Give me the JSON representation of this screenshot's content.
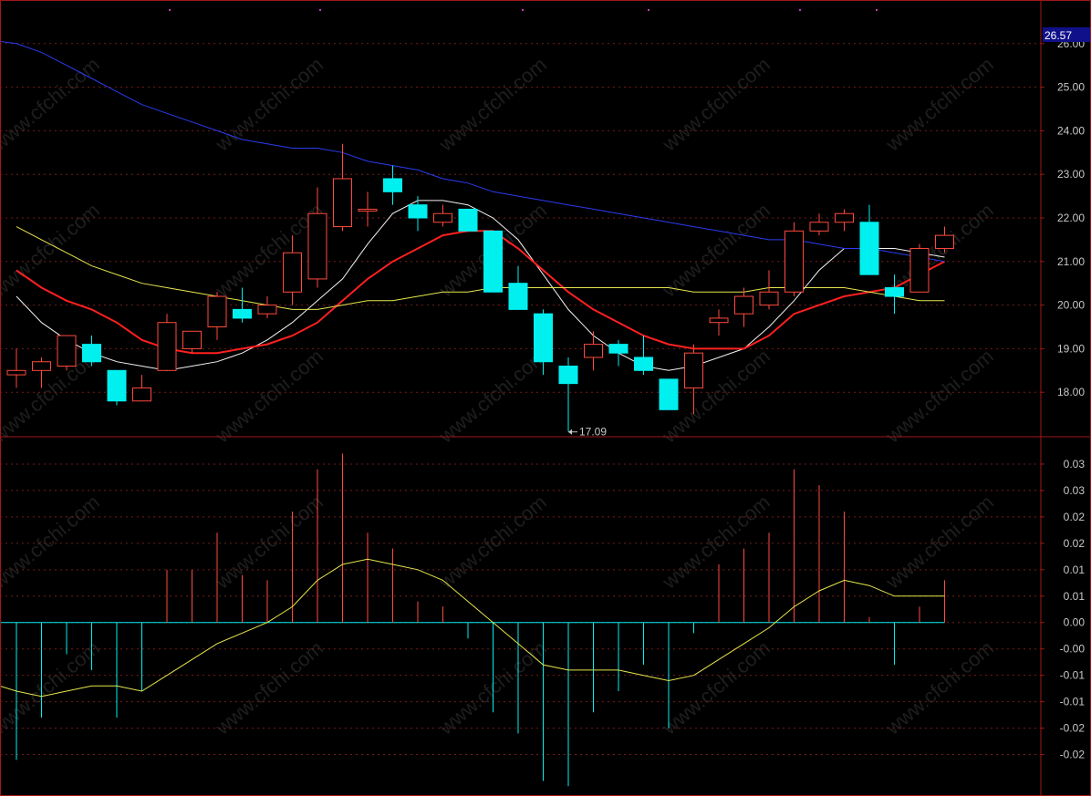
{
  "colors": {
    "background": "#000000",
    "frame": "#a01818",
    "grid": "#7a1a1a",
    "up": "#ff4a3d",
    "down": "#00f0f0",
    "ma_white": "#f2f2f2",
    "ma_red": "#ff2020",
    "ma_yellow": "#e6e64d",
    "ma_blue": "#2a3cf0",
    "axis_text": "#c8c8c8",
    "price_tag_bg": "#10108a",
    "watermark": "#1e1e1e"
  },
  "watermark_text": "www.cfchi.com",
  "chart_data": [
    {
      "type": "candlestick",
      "price_axis": {
        "ylim": [
          17.0,
          27.0
        ],
        "ticks": [
          "26.00",
          "25.00",
          "24.00",
          "23.00",
          "22.00",
          "21.00",
          "20.00",
          "19.00",
          "18.00"
        ],
        "last_price": "26.57"
      },
      "annotation": {
        "label": "17.09",
        "value": 17.09,
        "bar_index": 22
      },
      "candles": [
        {
          "o": 18.4,
          "h": 19.0,
          "l": 18.1,
          "c": 18.5
        },
        {
          "o": 18.5,
          "h": 18.8,
          "l": 18.1,
          "c": 18.7
        },
        {
          "o": 18.6,
          "h": 19.3,
          "l": 18.5,
          "c": 19.3
        },
        {
          "o": 19.1,
          "h": 19.3,
          "l": 18.6,
          "c": 18.7
        },
        {
          "o": 18.5,
          "h": 18.5,
          "l": 17.7,
          "c": 17.8
        },
        {
          "o": 17.8,
          "h": 18.4,
          "l": 17.8,
          "c": 18.1
        },
        {
          "o": 18.5,
          "h": 19.8,
          "l": 18.5,
          "c": 19.6
        },
        {
          "o": 19.0,
          "h": 19.4,
          "l": 18.9,
          "c": 19.4
        },
        {
          "o": 19.5,
          "h": 20.3,
          "l": 19.2,
          "c": 20.2
        },
        {
          "o": 19.9,
          "h": 20.4,
          "l": 19.6,
          "c": 19.7
        },
        {
          "o": 19.8,
          "h": 20.2,
          "l": 19.7,
          "c": 20.0
        },
        {
          "o": 20.3,
          "h": 21.6,
          "l": 20.0,
          "c": 21.2
        },
        {
          "o": 20.6,
          "h": 22.7,
          "l": 20.4,
          "c": 22.1
        },
        {
          "o": 21.8,
          "h": 23.7,
          "l": 21.7,
          "c": 22.9
        },
        {
          "o": 22.2,
          "h": 22.6,
          "l": 21.8,
          "c": 22.2
        },
        {
          "o": 22.9,
          "h": 23.2,
          "l": 22.3,
          "c": 22.6
        },
        {
          "o": 22.3,
          "h": 22.5,
          "l": 21.7,
          "c": 22.0
        },
        {
          "o": 21.9,
          "h": 22.3,
          "l": 21.8,
          "c": 22.1
        },
        {
          "o": 22.2,
          "h": 22.2,
          "l": 21.7,
          "c": 21.7
        },
        {
          "o": 21.7,
          "h": 21.7,
          "l": 20.3,
          "c": 20.3
        },
        {
          "o": 20.5,
          "h": 20.9,
          "l": 19.9,
          "c": 19.9
        },
        {
          "o": 19.8,
          "h": 19.9,
          "l": 18.4,
          "c": 18.7
        },
        {
          "o": 18.6,
          "h": 18.8,
          "l": 17.1,
          "c": 18.2
        },
        {
          "o": 18.8,
          "h": 19.4,
          "l": 18.5,
          "c": 19.1
        },
        {
          "o": 19.1,
          "h": 19.2,
          "l": 18.6,
          "c": 18.9
        },
        {
          "o": 18.8,
          "h": 19.3,
          "l": 18.4,
          "c": 18.5
        },
        {
          "o": 18.3,
          "h": 18.3,
          "l": 17.6,
          "c": 17.6
        },
        {
          "o": 18.1,
          "h": 19.1,
          "l": 17.5,
          "c": 18.9
        },
        {
          "o": 19.6,
          "h": 19.9,
          "l": 19.3,
          "c": 19.7
        },
        {
          "o": 19.8,
          "h": 20.4,
          "l": 19.5,
          "c": 20.2
        },
        {
          "o": 20.0,
          "h": 20.8,
          "l": 19.9,
          "c": 20.3
        },
        {
          "o": 20.3,
          "h": 21.9,
          "l": 20.2,
          "c": 21.7
        },
        {
          "o": 21.7,
          "h": 22.1,
          "l": 21.6,
          "c": 21.9
        },
        {
          "o": 21.9,
          "h": 22.2,
          "l": 21.7,
          "c": 22.1
        },
        {
          "o": 21.9,
          "h": 22.3,
          "l": 20.7,
          "c": 20.7
        },
        {
          "o": 20.4,
          "h": 20.7,
          "l": 19.8,
          "c": 20.2
        },
        {
          "o": 20.3,
          "h": 21.4,
          "l": 20.3,
          "c": 21.3
        },
        {
          "o": 21.3,
          "h": 21.8,
          "l": 21.2,
          "c": 21.6
        }
      ],
      "moving_averages": [
        {
          "color_key": "ma_white",
          "width": 1,
          "values": [
            20.2,
            19.6,
            19.2,
            18.9,
            18.7,
            18.6,
            18.5,
            18.6,
            18.7,
            18.9,
            19.2,
            19.6,
            20.1,
            20.6,
            21.4,
            22.1,
            22.4,
            22.4,
            22.3,
            22.0,
            21.5,
            20.7,
            19.9,
            19.3,
            18.9,
            18.6,
            18.5,
            18.6,
            18.8,
            19.0,
            19.5,
            20.1,
            20.8,
            21.3,
            21.3,
            21.3,
            21.2,
            21.1
          ]
        },
        {
          "color_key": "ma_red",
          "width": 2,
          "values": [
            20.8,
            20.4,
            20.1,
            19.9,
            19.6,
            19.2,
            19.0,
            18.9,
            18.9,
            19.0,
            19.1,
            19.3,
            19.6,
            20.1,
            20.6,
            21.0,
            21.3,
            21.6,
            21.7,
            21.7,
            21.3,
            20.8,
            20.3,
            19.9,
            19.6,
            19.3,
            19.1,
            19.0,
            19.0,
            19.0,
            19.3,
            19.8,
            20.0,
            20.2,
            20.3,
            20.4,
            20.7,
            21.0
          ]
        },
        {
          "color_key": "ma_yellow",
          "width": 1,
          "values": [
            21.8,
            21.5,
            21.2,
            20.9,
            20.7,
            20.5,
            20.4,
            20.3,
            20.2,
            20.1,
            20.0,
            19.9,
            19.9,
            20.0,
            20.1,
            20.1,
            20.2,
            20.3,
            20.3,
            20.4,
            20.4,
            20.4,
            20.4,
            20.4,
            20.4,
            20.4,
            20.4,
            20.3,
            20.3,
            20.3,
            20.4,
            20.4,
            20.4,
            20.4,
            20.3,
            20.2,
            20.1,
            20.1
          ]
        },
        {
          "color_key": "ma_blue",
          "width": 1,
          "values": [
            26.0,
            25.8,
            25.5,
            25.2,
            24.9,
            24.6,
            24.4,
            24.2,
            24.0,
            23.8,
            23.7,
            23.6,
            23.6,
            23.5,
            23.3,
            23.2,
            23.1,
            22.9,
            22.8,
            22.6,
            22.5,
            22.4,
            22.3,
            22.2,
            22.1,
            22.0,
            21.9,
            21.8,
            21.7,
            21.6,
            21.5,
            21.5,
            21.4,
            21.3,
            21.3,
            21.2,
            21.1,
            21.0
          ]
        }
      ]
    },
    {
      "type": "bar",
      "indicator_axis": {
        "ylim": [
          -0.0325,
          0.035
        ],
        "ticks": [
          {
            "v": 0.03,
            "label": "0.03"
          },
          {
            "v": 0.025,
            "label": "0.03"
          },
          {
            "v": 0.02,
            "label": "0.02"
          },
          {
            "v": 0.015,
            "label": "0.02"
          },
          {
            "v": 0.01,
            "label": "0.01"
          },
          {
            "v": 0.005,
            "label": "0.01"
          },
          {
            "v": 0.0,
            "label": "0.00"
          },
          {
            "v": -0.005,
            "label": "-0.00"
          },
          {
            "v": -0.01,
            "label": "-0.01"
          },
          {
            "v": -0.015,
            "label": "-0.01"
          },
          {
            "v": -0.02,
            "label": "-0.02"
          },
          {
            "v": -0.025,
            "label": "-0.02"
          }
        ]
      },
      "bars": [
        -0.026,
        -0.018,
        -0.006,
        -0.009,
        -0.018,
        -0.013,
        0.01,
        0.01,
        0.017,
        0.009,
        0.008,
        0.021,
        0.029,
        0.032,
        0.017,
        0.014,
        0.004,
        0.003,
        -0.003,
        -0.017,
        -0.021,
        -0.03,
        -0.031,
        -0.017,
        -0.013,
        -0.008,
        -0.02,
        -0.002,
        0.011,
        0.014,
        0.017,
        0.029,
        0.026,
        0.021,
        0.001,
        -0.008,
        0.003,
        0.008
      ],
      "signal_line": {
        "color_key": "ma_yellow",
        "values": [
          -0.013,
          -0.014,
          -0.013,
          -0.012,
          -0.012,
          -0.013,
          -0.01,
          -0.007,
          -0.004,
          -0.002,
          0.0,
          0.003,
          0.008,
          0.011,
          0.012,
          0.011,
          0.01,
          0.008,
          0.004,
          0.0,
          -0.004,
          -0.008,
          -0.009,
          -0.009,
          -0.009,
          -0.01,
          -0.011,
          -0.01,
          -0.007,
          -0.004,
          -0.001,
          0.003,
          0.006,
          0.008,
          0.007,
          0.005,
          0.005,
          0.005
        ]
      }
    }
  ]
}
